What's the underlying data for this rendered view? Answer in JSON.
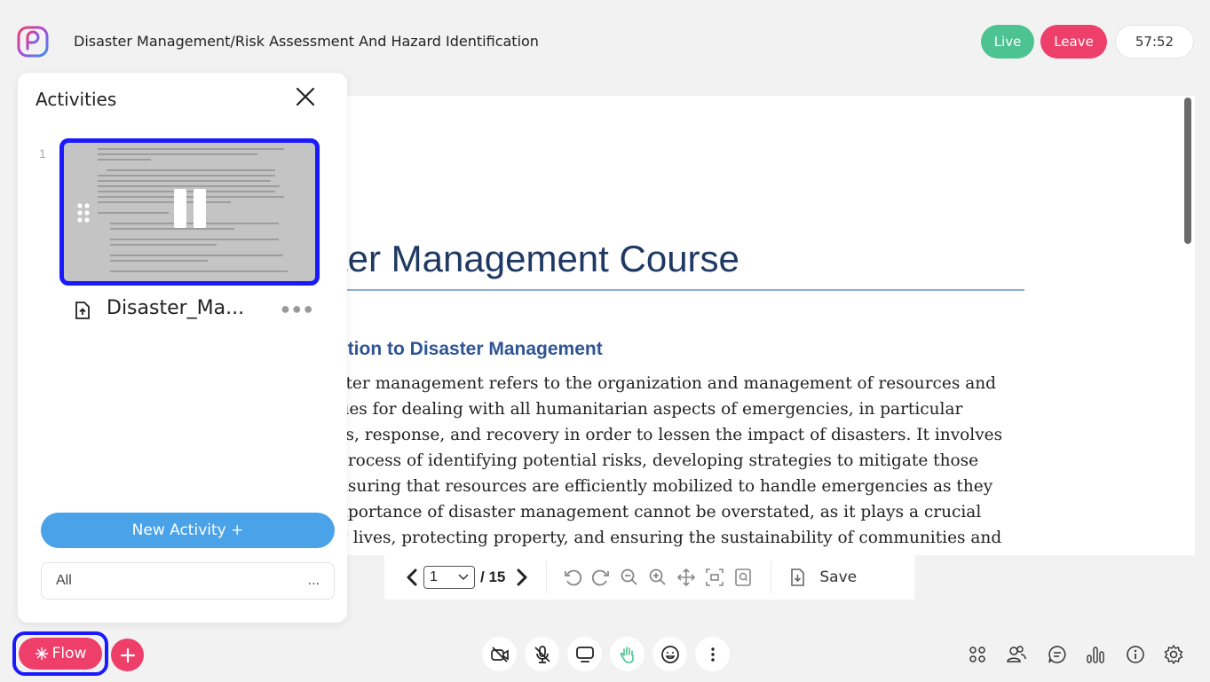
{
  "header": {
    "title": "Disaster Management/Risk Assessment And Hazard Identification",
    "live_label": "Live",
    "leave_label": "Leave",
    "timer": "57:52"
  },
  "document": {
    "heading": "ter Management Course",
    "subheading": "ction to Disaster Management",
    "lines": [
      "ster management refers to the organization and management of resources and",
      "ties for dealing with all humanitarian aspects of emergencies, in particular",
      "ss, response, and recovery in order to lessen the impact of disasters. It involves",
      "process of identifying potential risks, developing strategies to mitigate those",
      "nsuring that resources are efficiently mobilized to handle emergencies as they",
      "nportance of disaster management cannot be overstated, as it plays a crucial",
      "g lives, protecting property, and ensuring the sustainability of communities and"
    ]
  },
  "toolbar": {
    "current_page": "1",
    "total_pages": "/ 15",
    "save_label": "Save"
  },
  "activities": {
    "title": "Activities",
    "items": [
      {
        "index": "1",
        "name": "Disaster_Ma..."
      }
    ],
    "new_activity_label": "New Activity +",
    "filter_value": "All",
    "filter_more": "..."
  },
  "bottom_bar": {
    "flow_label": "Flow",
    "flow_icon": "sparkle-icon",
    "add_icon": "plus-icon",
    "controls": [
      "camera-off-icon",
      "mic-off-icon",
      "screen-share-icon",
      "raise-hand-icon",
      "emoji-icon",
      "more-vertical-icon"
    ],
    "right_icons": [
      "grid-icon",
      "participants-icon",
      "chat-icon",
      "poll-icon",
      "info-icon",
      "settings-icon"
    ]
  },
  "colors": {
    "accent_pink": "#ee3f6a",
    "live_green": "#4dc391",
    "new_activity_blue": "#4aa2e8",
    "focus_blue": "#1a1aff"
  }
}
